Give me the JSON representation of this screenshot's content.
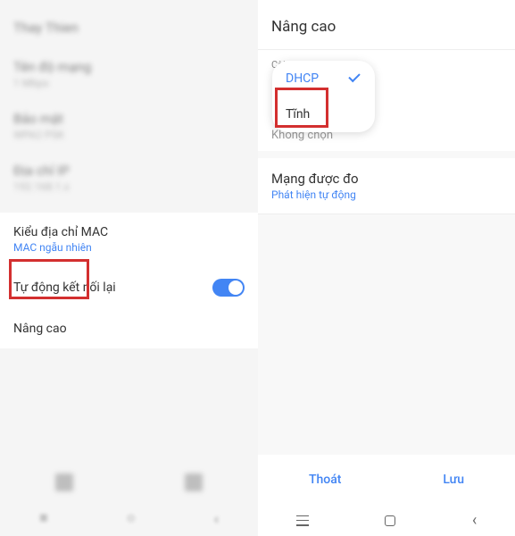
{
  "left_panel": {
    "blurred_rows": [
      {
        "title": "Thay Thien",
        "sub": ""
      },
      {
        "title": "Tên độ mạng",
        "sub": "1 Mbps"
      },
      {
        "title": "Bảo mật",
        "sub": "WPA2 PSK"
      },
      {
        "title": "Địa chỉ IP",
        "sub": "192.168.1.x"
      }
    ],
    "mac_title": "Kiểu địa chỉ MAC",
    "mac_sub": "MAC ngẫu nhiên",
    "auto_reconnect": "Tự động kết nối lại",
    "advanced": "Nâng cao"
  },
  "right_panel": {
    "title": "Nâng cao",
    "ip_settings_label": "Cài đặt IP",
    "dropdown": {
      "dhcp": "DHCP",
      "static": "Tĩnh"
    },
    "behind_text": "Không chọn",
    "metered_title": "Mạng được đo",
    "metered_sub": "Phát hiện tự động",
    "exit_btn": "Thoát",
    "save_btn": "Lưu"
  }
}
